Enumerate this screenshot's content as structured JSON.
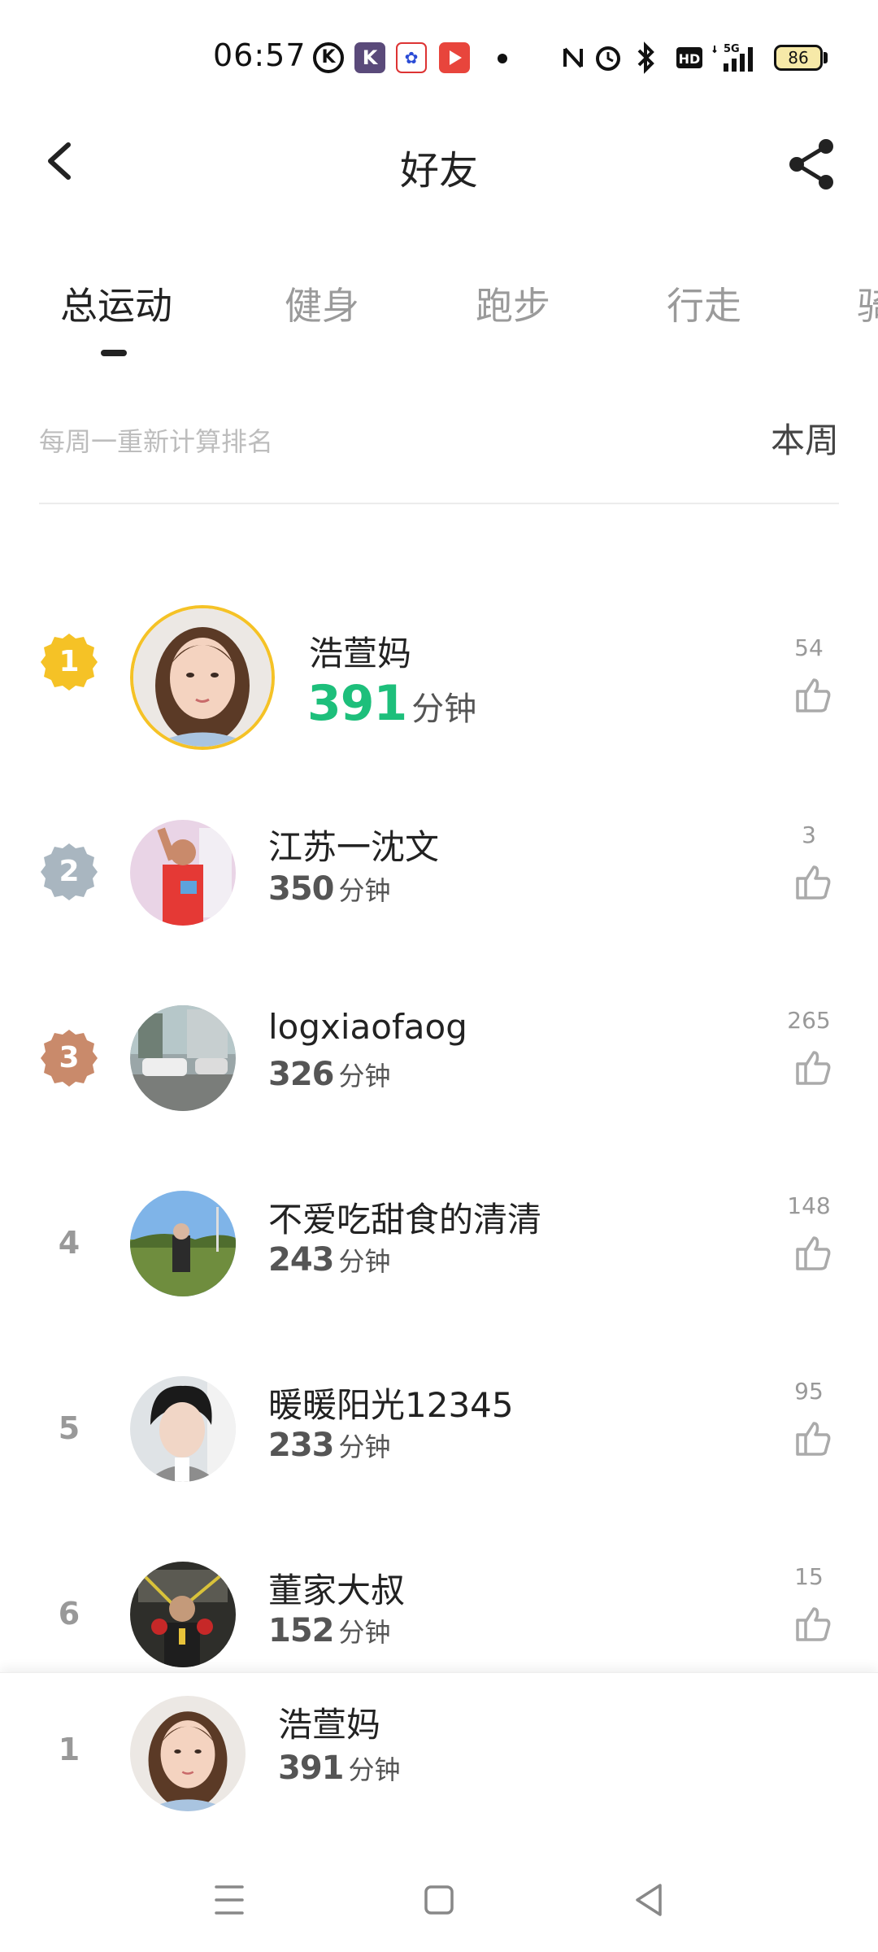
{
  "status_bar": {
    "time": "06:57",
    "network": "5G",
    "battery": "86",
    "icons": [
      "k-circle-icon",
      "k-app-icon",
      "baidu-icon",
      "video-icon",
      "dot-icon",
      "nfc-icon",
      "alarm-icon",
      "bluetooth-icon",
      "hd-icon",
      "signal-icon",
      "battery-icon"
    ]
  },
  "header": {
    "title": "好友",
    "back_icon": "chevron-left-icon",
    "share_icon": "share-icon"
  },
  "tabs": [
    {
      "label": "总运动",
      "active": true
    },
    {
      "label": "健身",
      "active": false
    },
    {
      "label": "跑步",
      "active": false
    },
    {
      "label": "行走",
      "active": false
    },
    {
      "label": "骑",
      "active": false
    }
  ],
  "info": {
    "note": "每周一重新计算排名",
    "period": "本周"
  },
  "unit": "分钟",
  "ranking": [
    {
      "rank": "1",
      "name": "浩萱妈",
      "minutes": "391",
      "likes": "54"
    },
    {
      "rank": "2",
      "name": "江苏一沈文",
      "minutes": "350",
      "likes": "3"
    },
    {
      "rank": "3",
      "name": "logxiaofaog",
      "minutes": "326",
      "likes": "265"
    },
    {
      "rank": "4",
      "name": "不爱吃甜食的清清",
      "minutes": "243",
      "likes": "148"
    },
    {
      "rank": "5",
      "name": "暖暖阳光12345",
      "minutes": "233",
      "likes": "95"
    },
    {
      "rank": "6",
      "name": "董家大叔",
      "minutes": "152",
      "likes": "15"
    }
  ],
  "self": {
    "rank": "1",
    "name": "浩萱妈",
    "minutes": "391"
  },
  "colors": {
    "accent_green": "#1dbf7b",
    "gold": "#f5c226",
    "silver": "#a9b6c0",
    "bronze": "#c98a6b"
  },
  "nav": [
    "menu-icon",
    "home-icon",
    "back-triangle-icon"
  ]
}
